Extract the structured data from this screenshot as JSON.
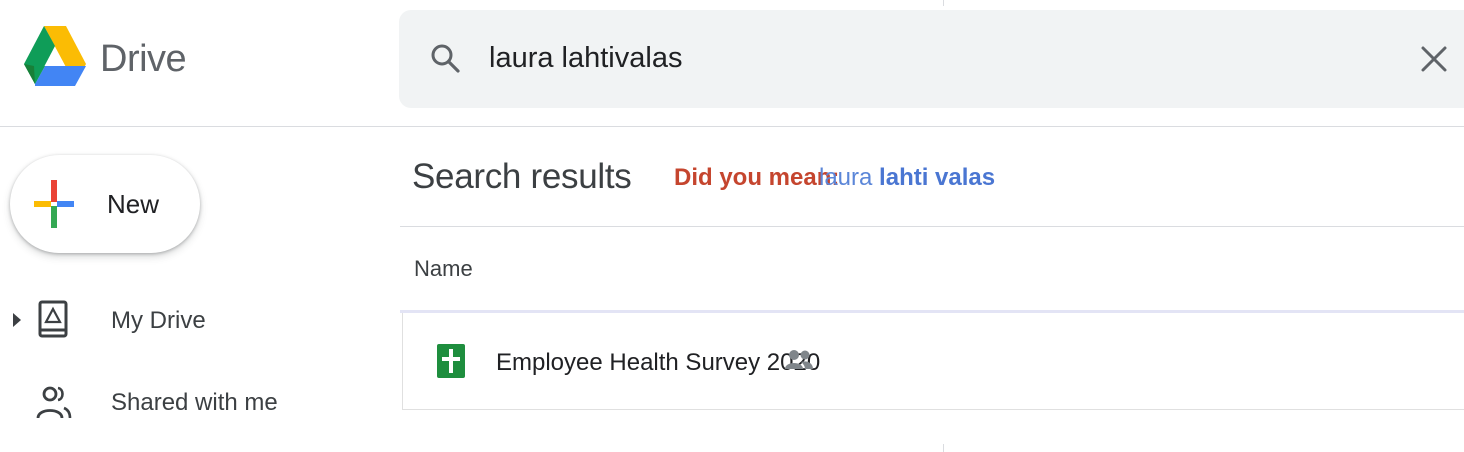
{
  "app": {
    "logo_text": "Drive"
  },
  "search": {
    "value": "laura lahtivalas",
    "icon": "search-icon",
    "clear_icon": "close-icon"
  },
  "sidebar": {
    "new_label": "New",
    "items": [
      {
        "label": "My Drive",
        "icon": "my-drive-icon",
        "expandable": true
      },
      {
        "label": "Shared with me",
        "icon": "shared-with-me-icon",
        "expandable": false
      }
    ]
  },
  "results": {
    "title": "Search results",
    "did_you_mean_label": "Did you mean:",
    "suggestion_plain": "laura",
    "suggestion_bold": "lahti valas",
    "column_name": "Name",
    "files": [
      {
        "name": "Employee Health Survey 2020",
        "type_icon": "google-sheets-icon",
        "shared": true
      }
    ]
  },
  "colors": {
    "did_you_mean": "#c5452e",
    "suggestion": "#4a76d2",
    "sheets_green": "#1e8e3e",
    "search_bg": "#f1f3f4"
  }
}
